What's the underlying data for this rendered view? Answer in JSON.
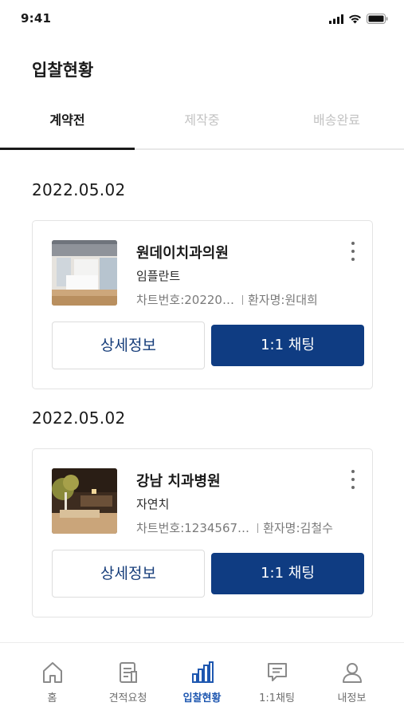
{
  "status_bar": {
    "time": "9:41"
  },
  "page_title": "입찰현황",
  "tabs": [
    {
      "label": "계약전",
      "active": true
    },
    {
      "label": "제작중",
      "active": false
    },
    {
      "label": "배송완료",
      "active": false
    }
  ],
  "groups": [
    {
      "date": "2022.05.02",
      "card": {
        "clinic_name": "원데이치과의원",
        "category": "임플란트",
        "chart_no": "차트번호:20220…",
        "patient": "환자명:원대희",
        "detail_label": "상세정보",
        "chat_label": "1:1 채팅"
      }
    },
    {
      "date": "2022.05.02",
      "card": {
        "clinic_name": "강남 치과병원",
        "category": "자연치",
        "chart_no": "차트번호:1234567…",
        "patient": "환자명:김철수",
        "detail_label": "상세정보",
        "chat_label": "1:1 채팅"
      }
    }
  ],
  "bottom_nav": [
    {
      "label": "홈",
      "icon": "home-icon",
      "active": false
    },
    {
      "label": "견적요청",
      "icon": "document-icon",
      "active": false
    },
    {
      "label": "입찰현황",
      "icon": "bar-chart-icon",
      "active": true
    },
    {
      "label": "1:1채팅",
      "icon": "chat-icon",
      "active": false
    },
    {
      "label": "내정보",
      "icon": "user-icon",
      "active": false
    }
  ],
  "colors": {
    "primary_button": "#0f3c82",
    "detail_text": "#163d7a",
    "nav_active": "#1e57b0",
    "tab_inactive": "#c3c3c3"
  }
}
